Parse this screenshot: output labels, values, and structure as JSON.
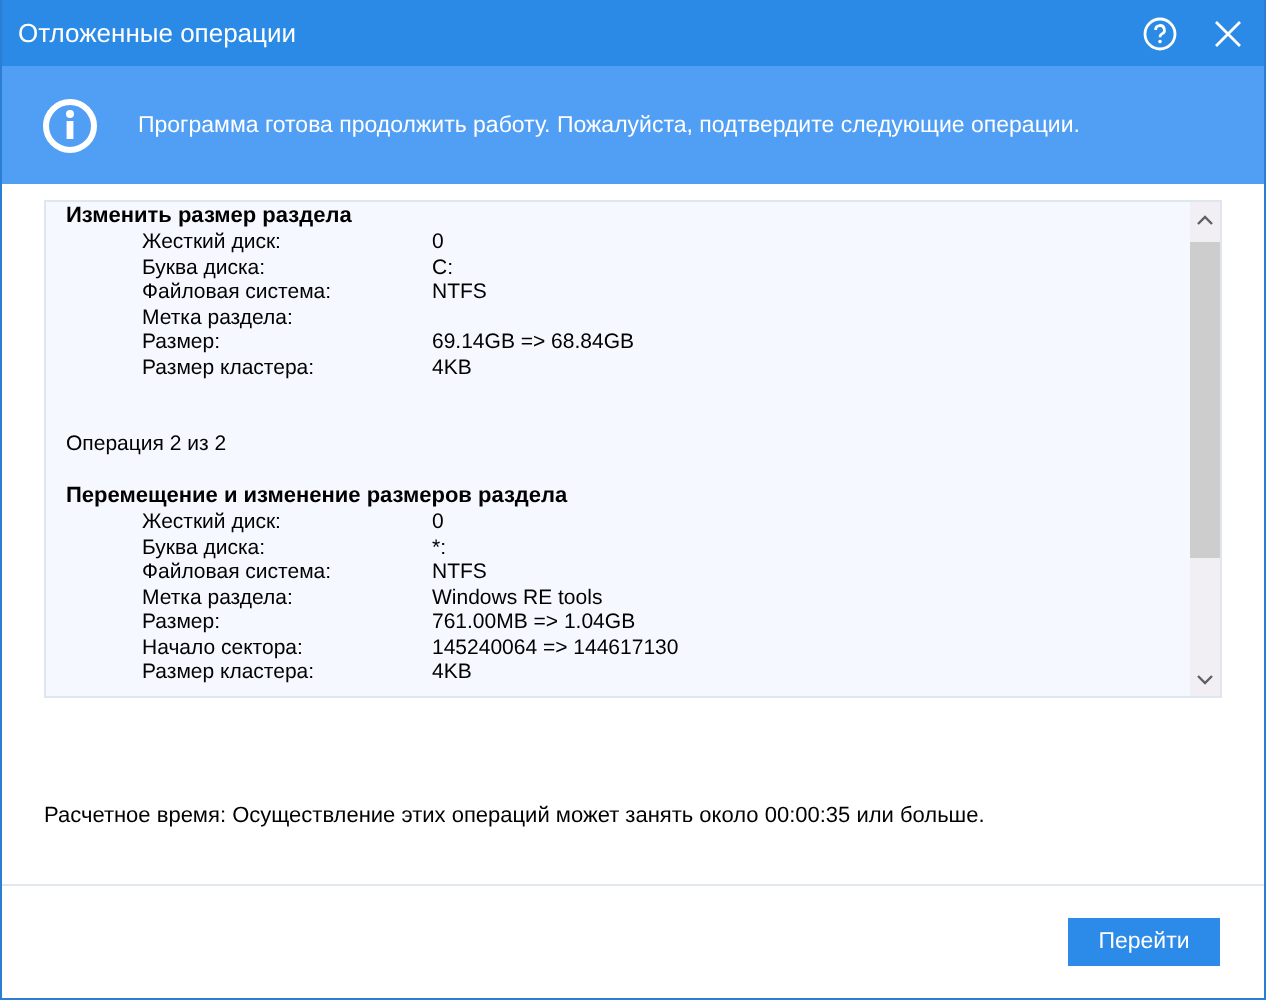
{
  "window": {
    "title": "Отложенные операции"
  },
  "banner": {
    "message": "Программа готова продолжить работу. Пожалуйста, подтвердите следующие операции."
  },
  "operations": [
    {
      "caption": "Изменить размер раздела",
      "fields": [
        {
          "label": "Жесткий диск:",
          "value": "0"
        },
        {
          "label": "Буква диска:",
          "value": "C:"
        },
        {
          "label": "Файловая система:",
          "value": "NTFS"
        },
        {
          "label": "Метка раздела:"
        },
        {
          "label": "Размер:",
          "value": "69.14GB => 68.84GB"
        },
        {
          "label": "Размер кластера:",
          "value": "4KB"
        }
      ]
    },
    {
      "counter": "Операция 2 из 2",
      "caption": "Перемещение и изменение размеров раздела",
      "fields": [
        {
          "label": "Жесткий диск:",
          "value": "0"
        },
        {
          "label": "Буква диска:",
          "value": "*:"
        },
        {
          "label": "Файловая система:",
          "value": "NTFS"
        },
        {
          "label": "Метка раздела:",
          "value": "Windows RE tools"
        },
        {
          "label": "Размер:",
          "value": "761.00MB => 1.04GB"
        },
        {
          "label": "Начало сектора:",
          "value": "145240064 => 144617130"
        },
        {
          "label": "Размер кластера:",
          "value": "4KB"
        }
      ]
    }
  ],
  "estimate": "Расчетное время: Осуществление этих операций может занять около 00:00:35 или больше.",
  "buttons": [
    {
      "label": "Перейти"
    }
  ]
}
